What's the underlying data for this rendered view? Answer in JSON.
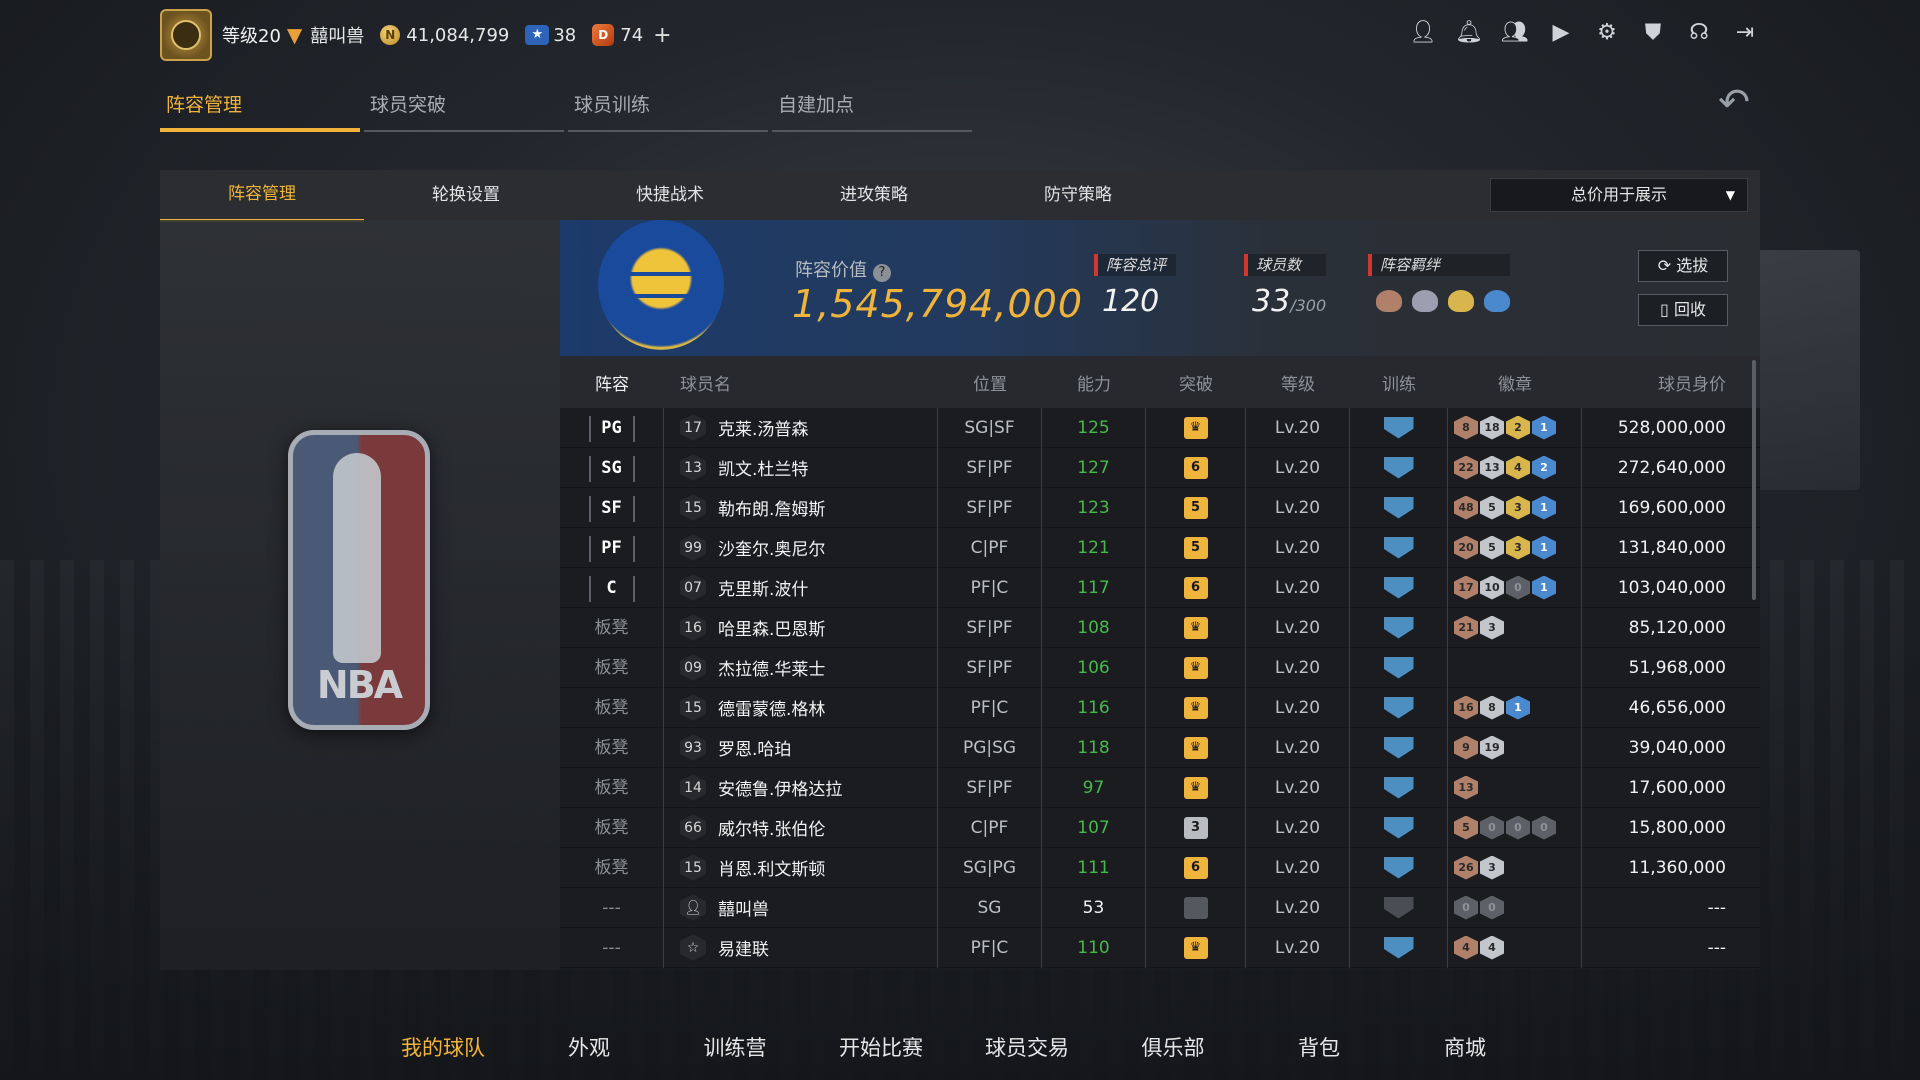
{
  "topbar": {
    "level": "等级20",
    "username": "囍叫兽",
    "coins": "41,084,799",
    "stars": "38",
    "gems": "74",
    "coin_glyph": "N",
    "gem_glyph": "D",
    "plus": "+"
  },
  "top_icons": [
    "person-icon",
    "bell-icon",
    "friends-icon",
    "video-icon",
    "gear-icon",
    "shield-icon",
    "headset-icon",
    "exit-icon"
  ],
  "main_tabs": [
    {
      "label": "阵容管理",
      "active": true
    },
    {
      "label": "球员突破",
      "active": false
    },
    {
      "label": "球员训练",
      "active": false
    },
    {
      "label": "自建加点",
      "active": false
    }
  ],
  "sub_tabs": [
    {
      "label": "阵容管理",
      "active": true
    },
    {
      "label": "轮换设置",
      "active": false
    },
    {
      "label": "快捷战术",
      "active": false
    },
    {
      "label": "进攻策略",
      "active": false
    },
    {
      "label": "防守策略",
      "active": false
    }
  ],
  "display_select": "总价用于展示",
  "summary": {
    "value_label": "阵容价值",
    "value": "1,545,794,000",
    "rating_label": "阵容总评",
    "rating": "120",
    "players_label": "球员数",
    "players": "33",
    "players_max": "/300",
    "bond_label": "阵容羁绊",
    "select_btn": "选拔",
    "recycle_btn": "回收"
  },
  "table": {
    "headers": [
      "阵容",
      "球员名",
      "位置",
      "能力",
      "突破",
      "等级",
      "训练",
      "徽章",
      "球员身价"
    ],
    "rows": [
      {
        "lineup": "PG",
        "starter": true,
        "jersey": "17",
        "name": "克莱.汤普森",
        "position": "SG|SF",
        "ability": "125",
        "breakthrough": "crown",
        "level": "Lv.20",
        "badges": [
          [
            "8",
            "b-br"
          ],
          [
            "18",
            "b-si"
          ],
          [
            "2",
            "b-go"
          ],
          [
            "1",
            "b-bl"
          ]
        ],
        "price": "528,000,000"
      },
      {
        "lineup": "SG",
        "starter": true,
        "jersey": "13",
        "name": "凯文.杜兰特",
        "position": "SF|PF",
        "ability": "127",
        "breakthrough": "6",
        "level": "Lv.20",
        "badges": [
          [
            "22",
            "b-br"
          ],
          [
            "13",
            "b-si"
          ],
          [
            "4",
            "b-go"
          ],
          [
            "2",
            "b-bl"
          ]
        ],
        "price": "272,640,000"
      },
      {
        "lineup": "SF",
        "starter": true,
        "jersey": "15",
        "name": "勒布朗.詹姆斯",
        "position": "SF|PF",
        "ability": "123",
        "breakthrough": "5",
        "level": "Lv.20",
        "badges": [
          [
            "48",
            "b-br"
          ],
          [
            "5",
            "b-si"
          ],
          [
            "3",
            "b-go"
          ],
          [
            "1",
            "b-bl"
          ]
        ],
        "price": "169,600,000"
      },
      {
        "lineup": "PF",
        "starter": true,
        "jersey": "99",
        "name": "沙奎尔.奥尼尔",
        "position": "C|PF",
        "ability": "121",
        "breakthrough": "5",
        "level": "Lv.20",
        "badges": [
          [
            "20",
            "b-br"
          ],
          [
            "5",
            "b-si"
          ],
          [
            "3",
            "b-go"
          ],
          [
            "1",
            "b-bl"
          ]
        ],
        "price": "131,840,000"
      },
      {
        "lineup": "C",
        "starter": true,
        "jersey": "07",
        "name": "克里斯.波什",
        "position": "PF|C",
        "ability": "117",
        "breakthrough": "6",
        "level": "Lv.20",
        "badges": [
          [
            "17",
            "b-br"
          ],
          [
            "10",
            "b-si"
          ],
          [
            "0",
            "b-dk"
          ],
          [
            "1",
            "b-bl"
          ]
        ],
        "price": "103,040,000"
      },
      {
        "lineup": "板凳",
        "starter": false,
        "jersey": "16",
        "name": "哈里森.巴恩斯",
        "position": "SF|PF",
        "ability": "108",
        "breakthrough": "crown",
        "level": "Lv.20",
        "badges": [
          [
            "21",
            "b-br"
          ],
          [
            "3",
            "b-si"
          ]
        ],
        "price": "85,120,000"
      },
      {
        "lineup": "板凳",
        "starter": false,
        "jersey": "09",
        "name": "杰拉德.华莱士",
        "position": "SF|PF",
        "ability": "106",
        "breakthrough": "crown",
        "level": "Lv.20",
        "badges": [],
        "price": "51,968,000"
      },
      {
        "lineup": "板凳",
        "starter": false,
        "jersey": "15",
        "name": "德雷蒙德.格林",
        "position": "PF|C",
        "ability": "116",
        "breakthrough": "crown",
        "level": "Lv.20",
        "badges": [
          [
            "16",
            "b-br"
          ],
          [
            "8",
            "b-si"
          ],
          [
            "1",
            "b-bl"
          ]
        ],
        "price": "46,656,000"
      },
      {
        "lineup": "板凳",
        "starter": false,
        "jersey": "93",
        "name": "罗恩.哈珀",
        "position": "PG|SG",
        "ability": "118",
        "breakthrough": "crown",
        "level": "Lv.20",
        "badges": [
          [
            "9",
            "b-br"
          ],
          [
            "19",
            "b-si"
          ]
        ],
        "price": "39,040,000"
      },
      {
        "lineup": "板凳",
        "starter": false,
        "jersey": "14",
        "name": "安德鲁.伊格达拉",
        "position": "SF|PF",
        "ability": "97",
        "breakthrough": "crown",
        "level": "Lv.20",
        "badges": [
          [
            "13",
            "b-br"
          ]
        ],
        "price": "17,600,000"
      },
      {
        "lineup": "板凳",
        "starter": false,
        "jersey": "66",
        "name": "威尔特.张伯伦",
        "position": "C|PF",
        "ability": "107",
        "breakthrough": "3",
        "level": "Lv.20",
        "badges": [
          [
            "5",
            "b-br"
          ],
          [
            "0",
            "b-dk"
          ],
          [
            "0",
            "b-dk"
          ],
          [
            "0",
            "b-dk"
          ]
        ],
        "price": "15,800,000"
      },
      {
        "lineup": "板凳",
        "starter": false,
        "jersey": "15",
        "name": "肖恩.利文斯顿",
        "position": "SG|PG",
        "ability": "111",
        "breakthrough": "6",
        "level": "Lv.20",
        "badges": [
          [
            "26",
            "b-br"
          ],
          [
            "3",
            "b-si"
          ]
        ],
        "price": "11,360,000"
      },
      {
        "lineup": "---",
        "starter": false,
        "jersey": "person",
        "name": "囍叫兽",
        "position": "SG",
        "ability": "53",
        "breakthrough": "none",
        "level": "Lv.20",
        "badges": [
          [
            "0",
            "b-dk"
          ],
          [
            "0",
            "b-dk"
          ]
        ],
        "price": "---",
        "custom": true
      },
      {
        "lineup": "---",
        "starter": false,
        "jersey": "star",
        "name": "易建联",
        "position": "PF|C",
        "ability": "110",
        "breakthrough": "crown",
        "level": "Lv.20",
        "badges": [
          [
            "4",
            "b-br"
          ],
          [
            "4",
            "b-si"
          ]
        ],
        "price": "---"
      }
    ]
  },
  "bottom_nav": [
    {
      "label": "我的球队",
      "active": true
    },
    {
      "label": "外观",
      "active": false
    },
    {
      "label": "训练营",
      "active": false
    },
    {
      "label": "开始比赛",
      "active": false
    },
    {
      "label": "球员交易",
      "active": false
    },
    {
      "label": "俱乐部",
      "active": false
    },
    {
      "label": "背包",
      "active": false
    },
    {
      "label": "商城",
      "active": false
    }
  ],
  "logo_text": "NBA",
  "colors": {
    "accent": "#f0b43c",
    "ability_green": "#49b84a",
    "starter_red": "#d2372f"
  }
}
